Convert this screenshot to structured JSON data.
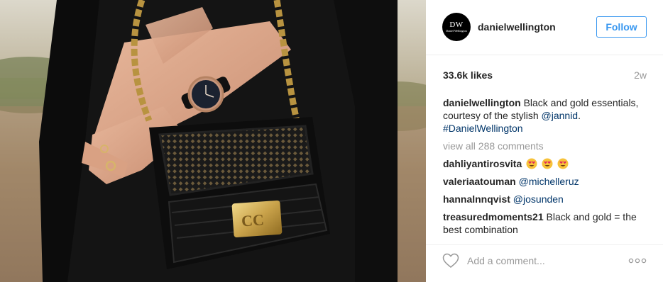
{
  "post": {
    "image_alt": "",
    "author": {
      "username": "danielwellington",
      "avatar_monogram": "DW",
      "avatar_wordmark": "Daniel Wellington"
    },
    "follow_label": "Follow",
    "likes": "33.6k likes",
    "timestamp": "2w",
    "caption": {
      "author": "danielwellington",
      "text": "Black and gold essentials, courtesy of the stylish ",
      "mention": "@jannid",
      "text_end": ".",
      "hashtag": "#DanielWellington"
    },
    "view_all": "view all 288 comments",
    "comments": [
      {
        "author": "dahliyantirosvita",
        "text": "",
        "emoji": "heart-eyes-emoji",
        "emoji_count": 3
      },
      {
        "author": "valeriaatouman",
        "mention": "@michelleruz"
      },
      {
        "author": "hannalnnqvist",
        "mention": "@josunden"
      },
      {
        "author": "treasuredmoments21",
        "text": "Black and gold = the best combination"
      }
    ],
    "add_comment_placeholder": "Add a comment...",
    "icons": {
      "like": "heart-outline-icon",
      "more": "more-options-icon"
    },
    "colors": {
      "accent": "#3897f0",
      "link": "#003569",
      "muted": "#999999",
      "text": "#262626"
    }
  }
}
